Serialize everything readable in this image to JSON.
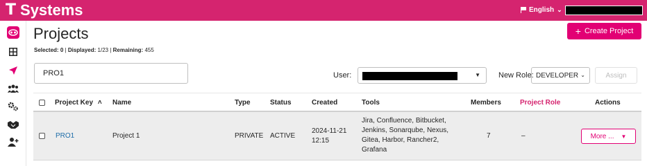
{
  "header": {
    "brand_mark": "T",
    "brand_name": "Systems",
    "language": "English",
    "colors": {
      "topbar": "#d5246f",
      "accent": "#e20074"
    }
  },
  "sidebar": {
    "items": [
      {
        "icon": "eye-mask-icon",
        "active": true
      },
      {
        "icon": "grid-icon",
        "active": false
      },
      {
        "icon": "send-icon",
        "active": false
      },
      {
        "icon": "group-icon",
        "active": false
      },
      {
        "icon": "gears-icon",
        "active": false
      },
      {
        "icon": "handshake-icon",
        "active": false
      },
      {
        "icon": "add-user-icon",
        "active": false
      }
    ]
  },
  "page": {
    "title": "Projects",
    "create_label": "Create Project",
    "counters": {
      "selected_label": "Selected:",
      "selected_value": "0",
      "displayed_label": "Displayed:",
      "displayed_value": "1/23",
      "remaining_label": "Remaining:",
      "remaining_value": "455"
    }
  },
  "filters": {
    "search_value": "PRO1",
    "user_label": "User:",
    "new_role_label": "New Role:",
    "new_role_value": "DEVELOPER",
    "assign_label": "Assign"
  },
  "table": {
    "columns": [
      "Project Key",
      "Name",
      "Type",
      "Status",
      "Created",
      "Tools",
      "Members",
      "Project Role",
      "Actions"
    ],
    "sort_indicator": "^",
    "rows": [
      {
        "key": "PRO1",
        "name": "Project 1",
        "type": "PRIVATE",
        "status": "ACTIVE",
        "created_date": "2024-11-21",
        "created_time": "12:15",
        "tools_lines": [
          "Jira, Confluence, Bitbucket,",
          "Jenkins, Sonarqube, Nexus,",
          "Gitea, Harbor, Rancher2,",
          "Grafana"
        ],
        "members": "7",
        "project_role": "–",
        "action_label": "More ..."
      }
    ]
  }
}
